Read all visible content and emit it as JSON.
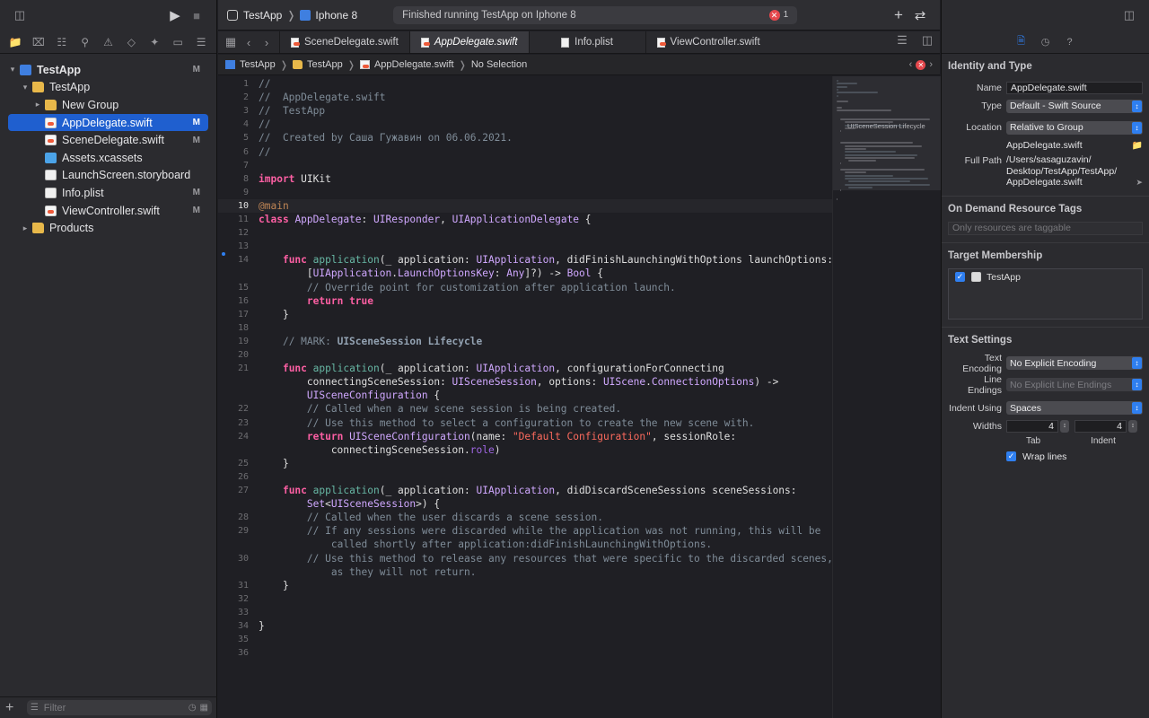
{
  "navigator": {
    "tree": [
      {
        "label": "TestApp",
        "icon": "project-icon",
        "level": 0,
        "disclosure": "open",
        "badge": "M",
        "bold": true
      },
      {
        "label": "TestApp",
        "icon": "folder-icon",
        "level": 1,
        "disclosure": "open",
        "badge": ""
      },
      {
        "label": "New Group",
        "icon": "folder-icon",
        "level": 2,
        "disclosure": "closed",
        "badge": ""
      },
      {
        "label": "AppDelegate.swift",
        "icon": "swift-file-icon",
        "level": 2,
        "disclosure": "",
        "badge": "M",
        "selected": true
      },
      {
        "label": "SceneDelegate.swift",
        "icon": "swift-file-icon",
        "level": 2,
        "disclosure": "",
        "badge": "M"
      },
      {
        "label": "Assets.xcassets",
        "icon": "asset-catalog-icon",
        "level": 2,
        "disclosure": "",
        "badge": ""
      },
      {
        "label": "LaunchScreen.storyboard",
        "icon": "storyboard-file-icon",
        "level": 2,
        "disclosure": "",
        "badge": ""
      },
      {
        "label": "Info.plist",
        "icon": "plist-file-icon",
        "level": 2,
        "disclosure": "",
        "badge": "M"
      },
      {
        "label": "ViewController.swift",
        "icon": "swift-file-icon",
        "level": 2,
        "disclosure": "",
        "badge": "M"
      },
      {
        "label": "Products",
        "icon": "folder-icon",
        "level": 1,
        "disclosure": "closed",
        "badge": ""
      }
    ],
    "filter_placeholder": "Filter"
  },
  "toolbar": {
    "scheme": "TestApp",
    "device": "Iphone 8",
    "activity_status": "Finished running TestApp on Iphone 8",
    "error_count": "1"
  },
  "tabs": [
    {
      "label": "SceneDelegate.swift",
      "active": false
    },
    {
      "label": "AppDelegate.swift",
      "active": true
    },
    {
      "label": "Info.plist",
      "active": false
    },
    {
      "label": "ViewController.swift",
      "active": false
    }
  ],
  "jump_bar": {
    "project": "TestApp",
    "group": "TestApp",
    "file": "AppDelegate.swift",
    "selection": "No Selection"
  },
  "editor": {
    "current_line": 10,
    "lines": [
      {
        "n": "1",
        "t": [
          [
            "c-com",
            "//"
          ]
        ]
      },
      {
        "n": "2",
        "t": [
          [
            "c-com",
            "//  AppDelegate.swift"
          ]
        ]
      },
      {
        "n": "3",
        "t": [
          [
            "c-com",
            "//  TestApp"
          ]
        ]
      },
      {
        "n": "4",
        "t": [
          [
            "c-com",
            "//"
          ]
        ]
      },
      {
        "n": "5",
        "t": [
          [
            "c-com",
            "//  Created by Саша Гужавин on 06.06.2021."
          ]
        ]
      },
      {
        "n": "6",
        "t": [
          [
            "c-com",
            "//"
          ]
        ]
      },
      {
        "n": "7",
        "t": []
      },
      {
        "n": "8",
        "t": [
          [
            "c-kw",
            "import"
          ],
          [
            "",
            " UIKit"
          ]
        ]
      },
      {
        "n": "9",
        "t": []
      },
      {
        "n": "10",
        "t": [
          [
            "c-attr",
            "@main"
          ]
        ]
      },
      {
        "n": "11",
        "t": [
          [
            "c-kw",
            "class"
          ],
          [
            "",
            " "
          ],
          [
            "c-type",
            "AppDelegate"
          ],
          [
            "",
            ": "
          ],
          [
            "c-type",
            "UIResponder"
          ],
          [
            "",
            ", "
          ],
          [
            "c-type",
            "UIApplicationDelegate"
          ],
          [
            "",
            " {"
          ]
        ]
      },
      {
        "n": "12",
        "t": []
      },
      {
        "n": "13",
        "t": []
      },
      {
        "n": "14",
        "t": [
          [
            "",
            "    "
          ],
          [
            "c-kw",
            "func"
          ],
          [
            "",
            " "
          ],
          [
            "c-fn",
            "application"
          ],
          [
            "",
            "(_ application: "
          ],
          [
            "c-type",
            "UIApplication"
          ],
          [
            "",
            ", didFinishLaunchingWithOptions launchOptions:"
          ]
        ]
      },
      {
        "n": "",
        "t": [
          [
            "",
            "        ["
          ],
          [
            "c-type",
            "UIApplication"
          ],
          [
            "",
            "."
          ],
          [
            "c-type",
            "LaunchOptionsKey"
          ],
          [
            "",
            ": "
          ],
          [
            "c-type",
            "Any"
          ],
          [
            "",
            "]?) -> "
          ],
          [
            "c-type",
            "Bool"
          ],
          [
            "",
            " {"
          ]
        ]
      },
      {
        "n": "15",
        "t": [
          [
            "",
            "        "
          ],
          [
            "c-com",
            "// Override point for customization after application launch."
          ]
        ]
      },
      {
        "n": "16",
        "t": [
          [
            "",
            "        "
          ],
          [
            "c-kw",
            "return"
          ],
          [
            "",
            " "
          ],
          [
            "c-kw",
            "true"
          ]
        ]
      },
      {
        "n": "17",
        "t": [
          [
            "",
            "    }"
          ]
        ]
      },
      {
        "n": "18",
        "t": []
      },
      {
        "n": "19",
        "t": [
          [
            "",
            "    "
          ],
          [
            "c-com",
            "// MARK: "
          ],
          [
            "c-mark",
            "UISceneSession Lifecycle"
          ]
        ]
      },
      {
        "n": "20",
        "t": []
      },
      {
        "n": "21",
        "t": [
          [
            "",
            "    "
          ],
          [
            "c-kw",
            "func"
          ],
          [
            "",
            " "
          ],
          [
            "c-fn",
            "application"
          ],
          [
            "",
            "(_ application: "
          ],
          [
            "c-type",
            "UIApplication"
          ],
          [
            "",
            ", configurationForConnecting"
          ]
        ]
      },
      {
        "n": "",
        "t": [
          [
            "",
            "        connectingSceneSession: "
          ],
          [
            "c-type",
            "UISceneSession"
          ],
          [
            "",
            ", options: "
          ],
          [
            "c-type",
            "UIScene"
          ],
          [
            "",
            "."
          ],
          [
            "c-type",
            "ConnectionOptions"
          ],
          [
            "",
            ") ->"
          ]
        ]
      },
      {
        "n": "",
        "t": [
          [
            "",
            "        "
          ],
          [
            "c-type",
            "UISceneConfiguration"
          ],
          [
            "",
            " {"
          ]
        ]
      },
      {
        "n": "22",
        "t": [
          [
            "",
            "        "
          ],
          [
            "c-com",
            "// Called when a new scene session is being created."
          ]
        ]
      },
      {
        "n": "23",
        "t": [
          [
            "",
            "        "
          ],
          [
            "c-com",
            "// Use this method to select a configuration to create the new scene with."
          ]
        ]
      },
      {
        "n": "24",
        "t": [
          [
            "",
            "        "
          ],
          [
            "c-kw",
            "return"
          ],
          [
            "",
            " "
          ],
          [
            "c-type",
            "UISceneConfiguration"
          ],
          [
            "",
            "(name: "
          ],
          [
            "c-str",
            "\"Default Configuration\""
          ],
          [
            "",
            ", sessionRole:"
          ]
        ]
      },
      {
        "n": "",
        "t": [
          [
            "",
            "            connectingSceneSession."
          ],
          [
            "c-prop",
            "role"
          ],
          [
            "",
            ")"
          ]
        ]
      },
      {
        "n": "25",
        "t": [
          [
            "",
            "    }"
          ]
        ]
      },
      {
        "n": "26",
        "t": []
      },
      {
        "n": "27",
        "t": [
          [
            "",
            "    "
          ],
          [
            "c-kw",
            "func"
          ],
          [
            "",
            " "
          ],
          [
            "c-fn",
            "application"
          ],
          [
            "",
            "(_ application: "
          ],
          [
            "c-type",
            "UIApplication"
          ],
          [
            "",
            ", didDiscardSceneSessions sceneSessions:"
          ]
        ]
      },
      {
        "n": "",
        "t": [
          [
            "",
            "        "
          ],
          [
            "c-type",
            "Set"
          ],
          [
            "",
            "<"
          ],
          [
            "c-type",
            "UISceneSession"
          ],
          [
            "",
            ">) {"
          ]
        ]
      },
      {
        "n": "28",
        "t": [
          [
            "",
            "        "
          ],
          [
            "c-com",
            "// Called when the user discards a scene session."
          ]
        ]
      },
      {
        "n": "29",
        "t": [
          [
            "",
            "        "
          ],
          [
            "c-com",
            "// If any sessions were discarded while the application was not running, this will be"
          ]
        ]
      },
      {
        "n": "",
        "t": [
          [
            "",
            "            "
          ],
          [
            "c-com",
            "called shortly after application:didFinishLaunchingWithOptions."
          ]
        ]
      },
      {
        "n": "30",
        "t": [
          [
            "",
            "        "
          ],
          [
            "c-com",
            "// Use this method to release any resources that were specific to the discarded scenes,"
          ]
        ]
      },
      {
        "n": "",
        "t": [
          [
            "",
            "            "
          ],
          [
            "c-com",
            "as they will not return."
          ]
        ]
      },
      {
        "n": "31",
        "t": [
          [
            "",
            "    }"
          ]
        ]
      },
      {
        "n": "32",
        "t": []
      },
      {
        "n": "33",
        "t": []
      },
      {
        "n": "34",
        "t": [
          [
            "",
            "}"
          ]
        ]
      },
      {
        "n": "35",
        "t": []
      },
      {
        "n": "36",
        "t": []
      }
    ]
  },
  "minimap": {
    "mark_label": "UISceneSession Lifecycle"
  },
  "inspector": {
    "identity": {
      "title": "Identity and Type",
      "name_label": "Name",
      "name_value": "AppDelegate.swift",
      "type_label": "Type",
      "type_value": "Default - Swift Source",
      "location_label": "Location",
      "location_value": "Relative to Group",
      "location_file": "AppDelegate.swift",
      "full_path_label": "Full Path",
      "full_path_lines": [
        "/Users/sasaguzavin/",
        "Desktop/TestApp/TestApp/",
        "AppDelegate.swift"
      ]
    },
    "odr": {
      "title": "On Demand Resource Tags",
      "placeholder": "Only resources are taggable"
    },
    "membership": {
      "title": "Target Membership",
      "target": "TestApp",
      "checked": true
    },
    "text_settings": {
      "title": "Text Settings",
      "encoding_label": "Text Encoding",
      "encoding_value": "No Explicit Encoding",
      "line_endings_label": "Line Endings",
      "line_endings_value": "No Explicit Line Endings",
      "indent_using_label": "Indent Using",
      "indent_using_value": "Spaces",
      "widths_label": "Widths",
      "tab_value": "4",
      "indent_value": "4",
      "tab_label": "Tab",
      "indent_label": "Indent",
      "wrap_label": "Wrap lines",
      "wrap_checked": true
    }
  },
  "colors": {
    "accent": "#2f7ff0",
    "selection": "#1f5fcf",
    "error": "#e5484d",
    "keyword": "#fc5fa3",
    "type": "#d0a8ff",
    "comment": "#7f8c98",
    "string": "#fc6a5d"
  }
}
